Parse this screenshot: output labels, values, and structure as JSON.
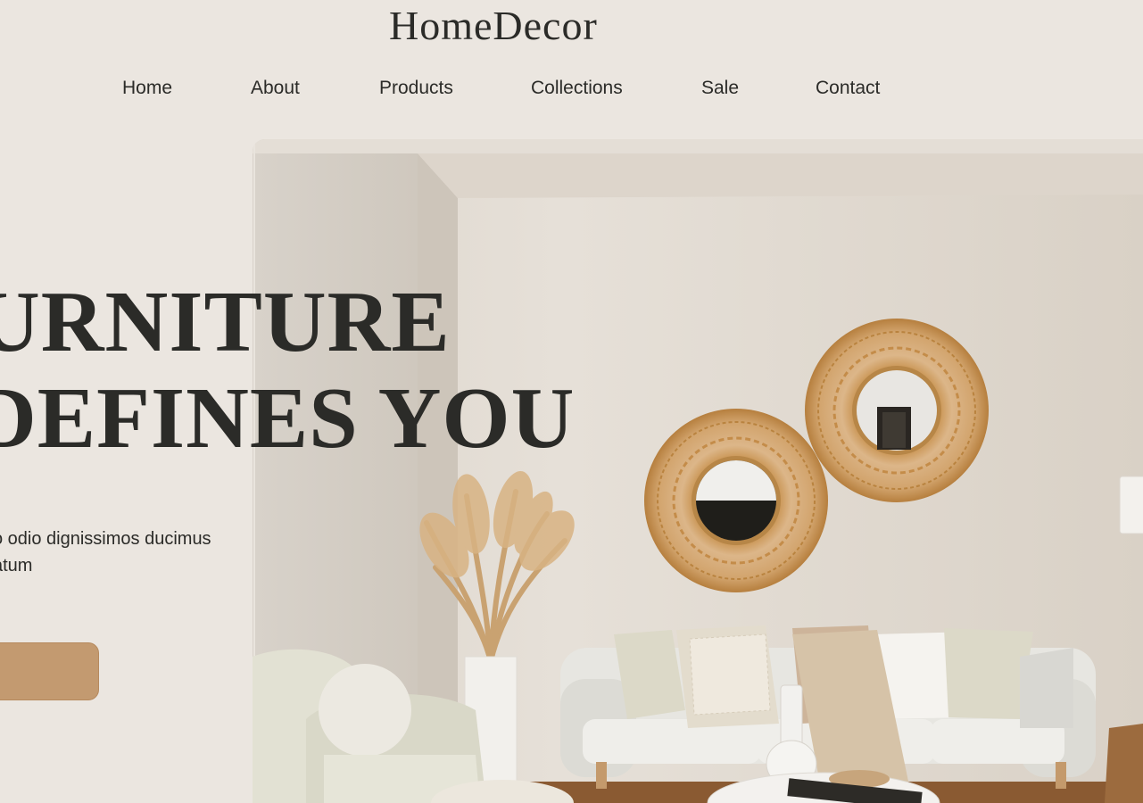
{
  "brand": {
    "name": "HomeDecor"
  },
  "nav": {
    "items": [
      {
        "label": "Home"
      },
      {
        "label": "About"
      },
      {
        "label": "Products"
      },
      {
        "label": "Collections"
      },
      {
        "label": "Sale"
      },
      {
        "label": "Contact"
      }
    ]
  },
  "hero": {
    "headline_line1": "URNITURE",
    "headline_line2": "DEFINES YOU",
    "paragraph_line1": "o odio dignissimos ducimus",
    "paragraph_line2": "atum",
    "cta_label": ""
  },
  "colors": {
    "background": "#ebe6e0",
    "text": "#2b2b28",
    "accent": "#c39a70"
  },
  "icons": [
    "living-room-photo"
  ]
}
